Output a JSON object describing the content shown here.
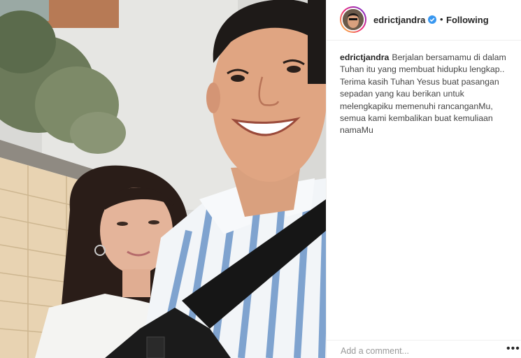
{
  "post": {
    "username": "edrictjandra",
    "follow_status": "Following",
    "separator": "•",
    "caption_lines": [
      "Berjalan bersamamu di dalam",
      "Tuhan itu yang membuat hidupku lengkap..",
      "Terima kasih Tuhan Yesus buat pasangan",
      "sepadan yang kau berikan untuk",
      "melengkapiku memenuhi rancanganMu,",
      "semua kami kembalikan buat kemuliaan",
      "namaMu"
    ]
  },
  "comment": {
    "placeholder": "Add a comment...",
    "more_label": "•••"
  },
  "icons": {
    "verified": "verified-badge-icon",
    "more": "more-options-icon"
  },
  "colors": {
    "verified_blue": "#3897f0",
    "text": "#262626",
    "muted": "#999999",
    "border": "#efefef"
  }
}
